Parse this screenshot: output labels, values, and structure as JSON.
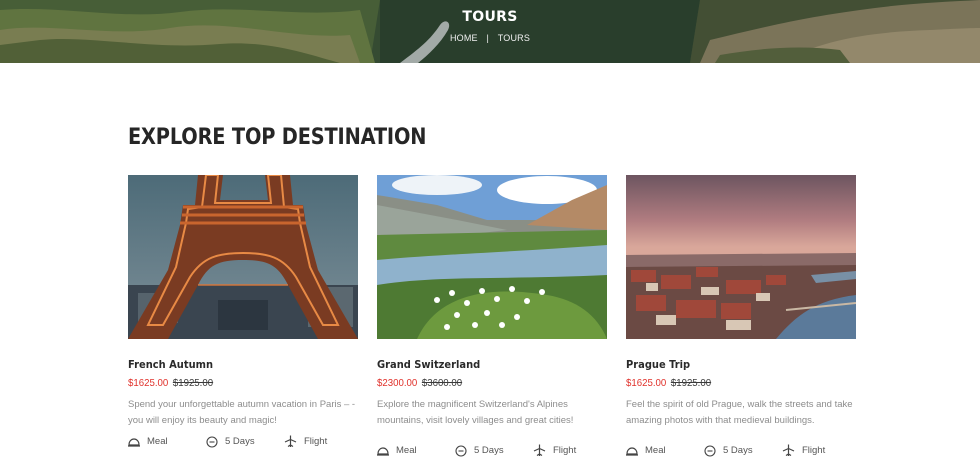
{
  "hero": {
    "title": "TOURS",
    "breadcrumb": {
      "home": "HOME",
      "separator": "|",
      "current": "TOURS"
    }
  },
  "section": {
    "title": "EXPLORE TOP DESTINATION"
  },
  "tours": [
    {
      "name": "French Autumn",
      "price": "$1625.00",
      "old_price": "$1925.00",
      "description": "Spend your unforgettable autumn vacation in Paris – -you will enjoy its beauty and magic!",
      "features": {
        "meal": "Meal",
        "duration": "5 Days",
        "flight": "Flight"
      }
    },
    {
      "name": "Grand Switzerland",
      "price": "$2300.00",
      "old_price": "$3600.00",
      "description": "Explore the magnificent Switzerland's Alpines mountains, visit lovely villages and great cities!",
      "features": {
        "meal": "Meal",
        "duration": "5 Days",
        "flight": "Flight"
      }
    },
    {
      "name": "Prague Trip",
      "price": "$1625.00",
      "old_price": "$1925.00",
      "description": "Feel the spirit of old Prague, walk the streets and take amazing photos with that medieval buildings.",
      "features": {
        "meal": "Meal",
        "duration": "5 Days",
        "flight": "Flight"
      }
    }
  ],
  "colors": {
    "sale_price": "#e0312b",
    "heading": "#262626",
    "muted_text": "#8d8d8d"
  }
}
